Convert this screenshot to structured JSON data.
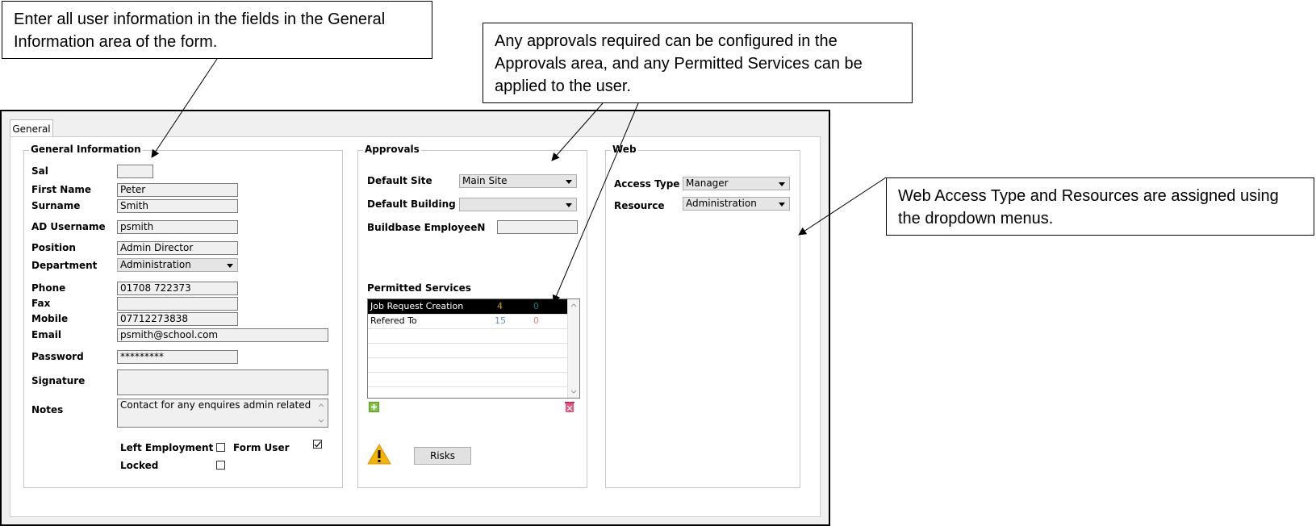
{
  "callouts": {
    "general_info": "Enter all user information in the fields in the General Information area of the form.",
    "approvals": "Any approvals required can be configured in the Approvals area, and any Permitted Services can be applied to the user.",
    "web": "Web Access Type and Resources are assigned using the dropdown menus."
  },
  "tabs": [
    "General"
  ],
  "general_information": {
    "title": "General Information",
    "sal_label": "Sal",
    "sal_value": "",
    "first_name_label": "First Name",
    "first_name_value": "Peter",
    "surname_label": "Surname",
    "surname_value": "Smith",
    "ad_username_label": "AD Username",
    "ad_username_value": "psmith",
    "position_label": "Position",
    "position_value": "Admin Director",
    "department_label": "Department",
    "department_value": "Administration",
    "phone_label": "Phone",
    "phone_value": "01708 722373",
    "fax_label": "Fax",
    "fax_value": "",
    "mobile_label": "Mobile",
    "mobile_value": "07712273838",
    "email_label": "Email",
    "email_value": "psmith@school.com",
    "password_label": "Password",
    "password_value": "*********",
    "signature_label": "Signature",
    "notes_label": "Notes",
    "notes_value": "Contact for any enquires admin related",
    "left_employment_label": "Left Employment",
    "left_employment_checked": false,
    "form_user_label": "Form User",
    "form_user_checked": true,
    "locked_label": "Locked",
    "locked_checked": false
  },
  "approvals": {
    "title": "Approvals",
    "default_site_label": "Default Site",
    "default_site_value": "Main Site",
    "default_building_label": "Default Building",
    "default_building_value": "",
    "buildbase_label": "Buildbase EmployeeN",
    "buildbase_value": "",
    "permitted_services_label": "Permitted Services",
    "services": [
      {
        "name": "Job Request Creation",
        "a": "4",
        "b": "0",
        "selected": true
      },
      {
        "name": "Refered To",
        "a": "15",
        "b": "0",
        "selected": false
      }
    ],
    "risks_button": "Risks",
    "colors": {
      "a_selected": "#c8a000",
      "b_selected": "#008080",
      "a": "#6a8fd8",
      "b": "#f08080"
    }
  },
  "web": {
    "title": "Web",
    "access_type_label": "Access Type",
    "access_type_value": "Manager",
    "resource_label": "Resource",
    "resource_value": "Administration"
  }
}
